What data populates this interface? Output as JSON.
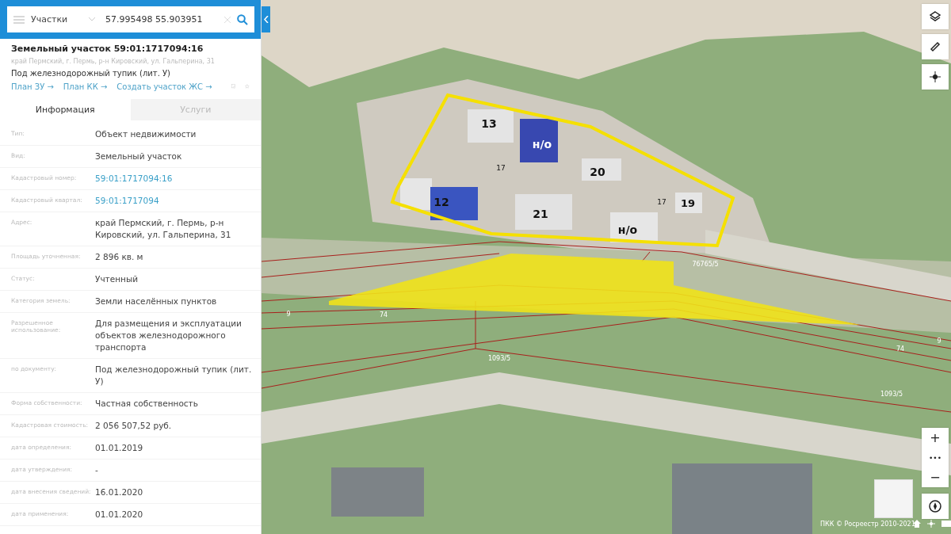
{
  "search": {
    "layer": "Участки",
    "value": "57.995498 55.903951"
  },
  "object": {
    "title": "Земельный участок 59:01:1717094:16",
    "address": "край Пермский, г. Пермь, р-н Кировский, ул. Гальперина, 31",
    "purpose": "Под железнодорожный тупик (лит. У)",
    "links": [
      "План ЗУ →",
      "План КК →",
      "Создать участок ЖС →"
    ]
  },
  "tabs": [
    {
      "label": "Информация",
      "selected": true
    },
    {
      "label": "Услуги",
      "selected": false
    }
  ],
  "fields": [
    {
      "label": "Тип:",
      "value": "Объект недвижимости",
      "kind": "text"
    },
    {
      "label": "Вид:",
      "value": "Земельный участок",
      "kind": "text"
    },
    {
      "label": "Кадастровый номер:",
      "value": "59:01:1717094:16",
      "kind": "link"
    },
    {
      "label": "Кадастровый квартал:",
      "value": "59:01:1717094",
      "kind": "link"
    },
    {
      "label": "Адрес:",
      "value": "край Пермский, г. Пермь, р-н Кировский, ул. Гальперина, 31",
      "kind": "text"
    },
    {
      "label": "Площадь уточненная:",
      "value": "2 896 кв. м",
      "kind": "text"
    },
    {
      "label": "Статус:",
      "value": "Учтенный",
      "kind": "text"
    },
    {
      "label": "Категория земель:",
      "value": "Земли населённых пунктов",
      "kind": "text"
    },
    {
      "label": "Разрешенное использование:",
      "value": "Для размещения и эксплуатации объектов железнодорожного транспорта",
      "kind": "text"
    },
    {
      "label": "по документу:",
      "value": "Под железнодорожный тупик (лит. У)",
      "kind": "text"
    },
    {
      "label": "Форма собственности:",
      "value": "Частная собственность",
      "kind": "text"
    },
    {
      "label": "Кадастровая стоимость:",
      "value": "2 056 507,52 руб.",
      "kind": "text"
    },
    {
      "label": "дата определения:",
      "value": "01.01.2019",
      "kind": "text"
    },
    {
      "label": "дата утверждения:",
      "value": "-",
      "kind": "text"
    },
    {
      "label": "дата внесения сведений:",
      "value": "16.01.2020",
      "kind": "text"
    },
    {
      "label": "дата применения:",
      "value": "01.01.2020",
      "kind": "text"
    }
  ],
  "map": {
    "labels": [
      "13",
      "н/о",
      "20",
      "12",
      "21",
      "19",
      "н/о",
      "17",
      "17",
      "76765/5",
      "9",
      "74",
      "1093/5",
      "1093/5",
      "74",
      "9"
    ],
    "zoom": [
      "+",
      "•••",
      "−"
    ],
    "attribution": "ПКК © Росреестр 2010-2021"
  }
}
